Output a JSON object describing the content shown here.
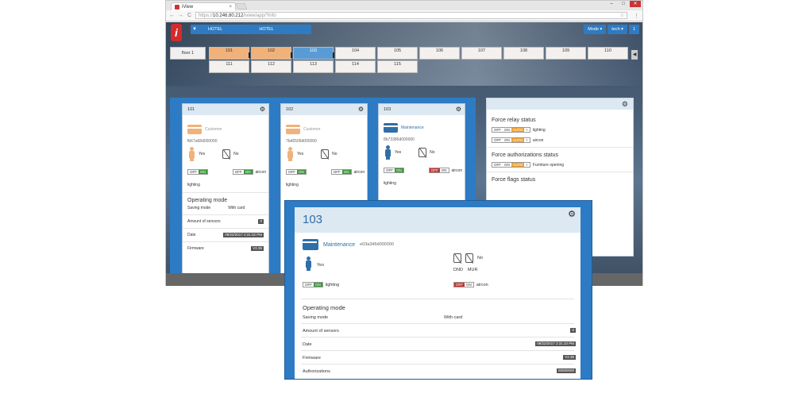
{
  "browser": {
    "tab_title": "iView",
    "tab_close": "×",
    "win_min": "–",
    "win_max": "□",
    "win_close": "✕",
    "url_prefix": "https://",
    "url_host": "10.246.80.212",
    "url_path": "/iview/app/?info",
    "nav_back": "←",
    "nav_forward": "→",
    "nav_reload": "C",
    "star": "☆",
    "menu": "⋮"
  },
  "app": {
    "logo": "i",
    "filter_icon": "▼",
    "hotel_select_1": "HOTEL",
    "hotel_select_2": "HOTEL",
    "mode_button": "Mode ▾",
    "user_button": "tech ▾",
    "info_button": "1",
    "scroll_left": "◀",
    "floor": "floor 1",
    "rooms_row1": [
      "101",
      "102",
      "103",
      "104",
      "105",
      "106",
      "107",
      "108",
      "109",
      "110"
    ],
    "rooms_row2": [
      "111",
      "112",
      "113",
      "114",
      "115"
    ]
  },
  "cards": [
    {
      "room": "101",
      "type": "Customer",
      "card_id": "fb67a68d000000",
      "presence": "Yes",
      "dnd": "No",
      "lighting_off": "OFF",
      "lighting_on": "ON",
      "aircon_off": "OFF",
      "aircon_on": "ON",
      "aircon_label": "aircon",
      "lighting_label": "lighting",
      "op_title": "Operating mode",
      "saving_mode": "Saving mode",
      "with_card": "With card",
      "sensors_label": "Amount of sensors",
      "sensors": "0",
      "date_label": "Date",
      "date": "09/22/2017 2:31:32 PM",
      "firmware_label": "Firmware",
      "firmware": "V2.36"
    },
    {
      "room": "102",
      "type": "Customer",
      "card_id": "7bd6509d000000",
      "presence": "Yes",
      "dnd": "No",
      "lighting_off": "OFF",
      "lighting_on": "ON",
      "aircon_off": "OFF",
      "aircon_on": "ON",
      "aircon_label": "aircon",
      "lighting_label": "lighting"
    },
    {
      "room": "103",
      "type": "Maintenance",
      "card_id": "8b73386d000000",
      "presence": "Yes",
      "dnd": "No",
      "lighting_off": "OFF",
      "lighting_on": "ON",
      "aircon_off": "OFF",
      "aircon_on": "ON",
      "aircon_label": "aircon",
      "lighting_label": "lighting"
    }
  ],
  "force": {
    "relay_title": "Force relay status",
    "relay_rows": [
      {
        "off": "OFF",
        "on": "ON",
        "auto": "AUTO",
        "plus": "+",
        "label": "lighting"
      },
      {
        "off": "OFF",
        "on": "ON",
        "auto": "AUTO",
        "plus": "+",
        "label": "aircon"
      }
    ],
    "auth_title": "Force authorizations status",
    "auth_row": {
      "off": "OFF",
      "on": "ON",
      "auto": "AUTO",
      "plus": "+",
      "label": "Furniture opening"
    },
    "flags_title": "Force flags status"
  },
  "popup": {
    "room": "103",
    "type": "Maintenance",
    "card_id": "e03a346d000000",
    "presence": "Yes",
    "dnd": "No",
    "dnd_label": "DND",
    "mur_label": "MUR",
    "lighting_off": "OFF",
    "lighting_on": "ON",
    "lighting_label": "lighting",
    "aircon_off": "OFF",
    "aircon_on": "ON",
    "aircon_label": "aircon",
    "op_title": "Operating mode",
    "saving_mode": "Saving mode",
    "with_card": "With card",
    "sensors_label": "Amount of sensors",
    "sensors": "0",
    "date_label": "Date",
    "date": "09/22/2017 2:31:10 PM",
    "firmware_label": "Firmware",
    "firmware": "V2.36",
    "auth_label": "Authorizations",
    "auth": "00000000"
  },
  "colors": {
    "accent_blue": "#2d7bc4",
    "occupied_orange": "#f0b27a",
    "on_green": "#3a9a3a",
    "off_red": "#cc3333",
    "auto_orange": "#f0a030"
  },
  "icons": [
    "tab-favicon-icon",
    "filter-icon",
    "gear-icon",
    "customer-card-icon",
    "maintenance-card-icon",
    "person-icon",
    "dnd-icon",
    "mur-icon",
    "star-icon",
    "menu-icon"
  ]
}
